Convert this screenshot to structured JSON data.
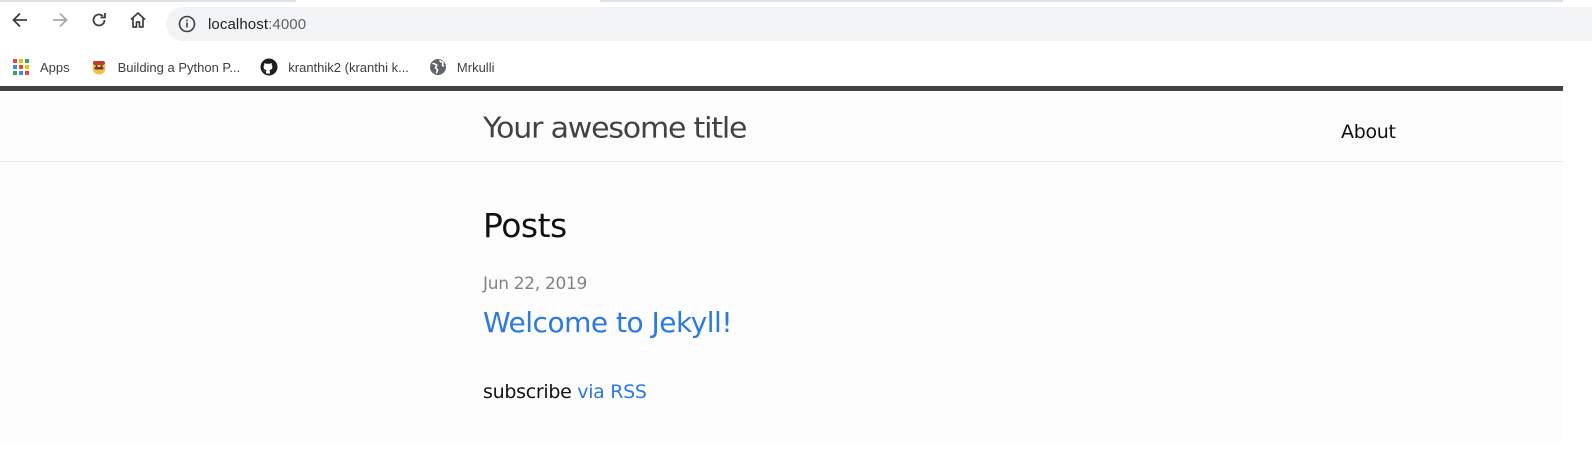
{
  "browser": {
    "address_bar": {
      "host": "localhost",
      "port": ":4000"
    },
    "bookmarks": [
      {
        "label": "Apps",
        "icon": "apps-grid-icon"
      },
      {
        "label": "Building a Python P...",
        "icon": "mascot-favicon-icon"
      },
      {
        "label": "kranthik2 (kranthi k...",
        "icon": "github-icon"
      },
      {
        "label": "Mrkulli",
        "icon": "globe-icon"
      }
    ]
  },
  "site": {
    "title": "Your awesome title",
    "nav": {
      "about": "About"
    }
  },
  "main": {
    "heading": "Posts",
    "posts": [
      {
        "date": "Jun 22, 2019",
        "title": "Welcome to Jekyll!"
      }
    ],
    "subscribe_text": "subscribe",
    "rss_link": "via RSS"
  },
  "colors": {
    "link": "#2a7ae2",
    "header_border": "#424242",
    "meta_text": "#828282",
    "page_bg": "#fdfdfd"
  }
}
